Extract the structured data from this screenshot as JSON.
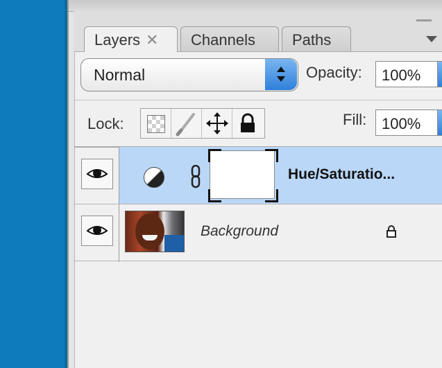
{
  "tabs": [
    {
      "label": "Layers",
      "active": true,
      "close_glyph": "✕"
    },
    {
      "label": "Channels",
      "active": false
    },
    {
      "label": "Paths",
      "active": false
    }
  ],
  "blend_mode": {
    "value": "Normal",
    "icon": "stepper-arrows-icon"
  },
  "opacity": {
    "label": "Opacity:",
    "value": "100%"
  },
  "fill": {
    "label": "Fill:",
    "value": "100%"
  },
  "lock": {
    "label": "Lock:",
    "options": [
      "lock-transparent-pixels-icon",
      "lock-image-pixels-icon",
      "lock-position-icon",
      "lock-all-icon"
    ]
  },
  "layers": [
    {
      "name": "Hue/Saturatio...",
      "type": "adjustment",
      "visible": true,
      "selected": true,
      "icons": [
        "eye-icon",
        "adjustment-half-circle-icon",
        "link-chain-icon",
        "layer-mask-thumbnail"
      ]
    },
    {
      "name": "Background",
      "type": "image",
      "visible": true,
      "selected": false,
      "locked": true,
      "icons": [
        "eye-icon",
        "photo-thumbnail",
        "lock-icon"
      ]
    }
  ],
  "colors": {
    "desktop_blue": "#0e7cbc",
    "selected_row": "#bad7f7",
    "stepper_blue": "#2f7fd9"
  }
}
